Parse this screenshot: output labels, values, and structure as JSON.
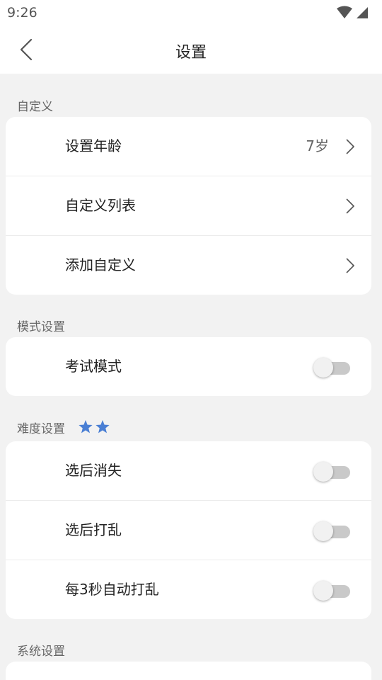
{
  "status_bar": {
    "time": "9:26",
    "icons": [
      "wifi-icon",
      "signal-icon"
    ]
  },
  "header": {
    "title": "设置",
    "back_icon": "chevron-left-icon"
  },
  "sections": {
    "custom": {
      "title": "自定义",
      "rows": [
        {
          "label": "设置年龄",
          "value": "7岁"
        },
        {
          "label": "自定义列表"
        },
        {
          "label": "添加自定义"
        }
      ]
    },
    "mode": {
      "title": "模式设置",
      "rows": [
        {
          "label": "考试模式",
          "on": false
        }
      ]
    },
    "difficulty": {
      "title": "难度设置",
      "stars": 2,
      "star_color": "#4a7fd4",
      "rows": [
        {
          "label": "选后消失",
          "on": false
        },
        {
          "label": "选后打乱",
          "on": false
        },
        {
          "label": "每3秒自动打乱",
          "on": false
        }
      ]
    },
    "system": {
      "title": "系统设置"
    }
  },
  "colors": {
    "background": "#f2f2f2",
    "card": "#ffffff",
    "toggle_off_track": "#c9c9c9"
  }
}
